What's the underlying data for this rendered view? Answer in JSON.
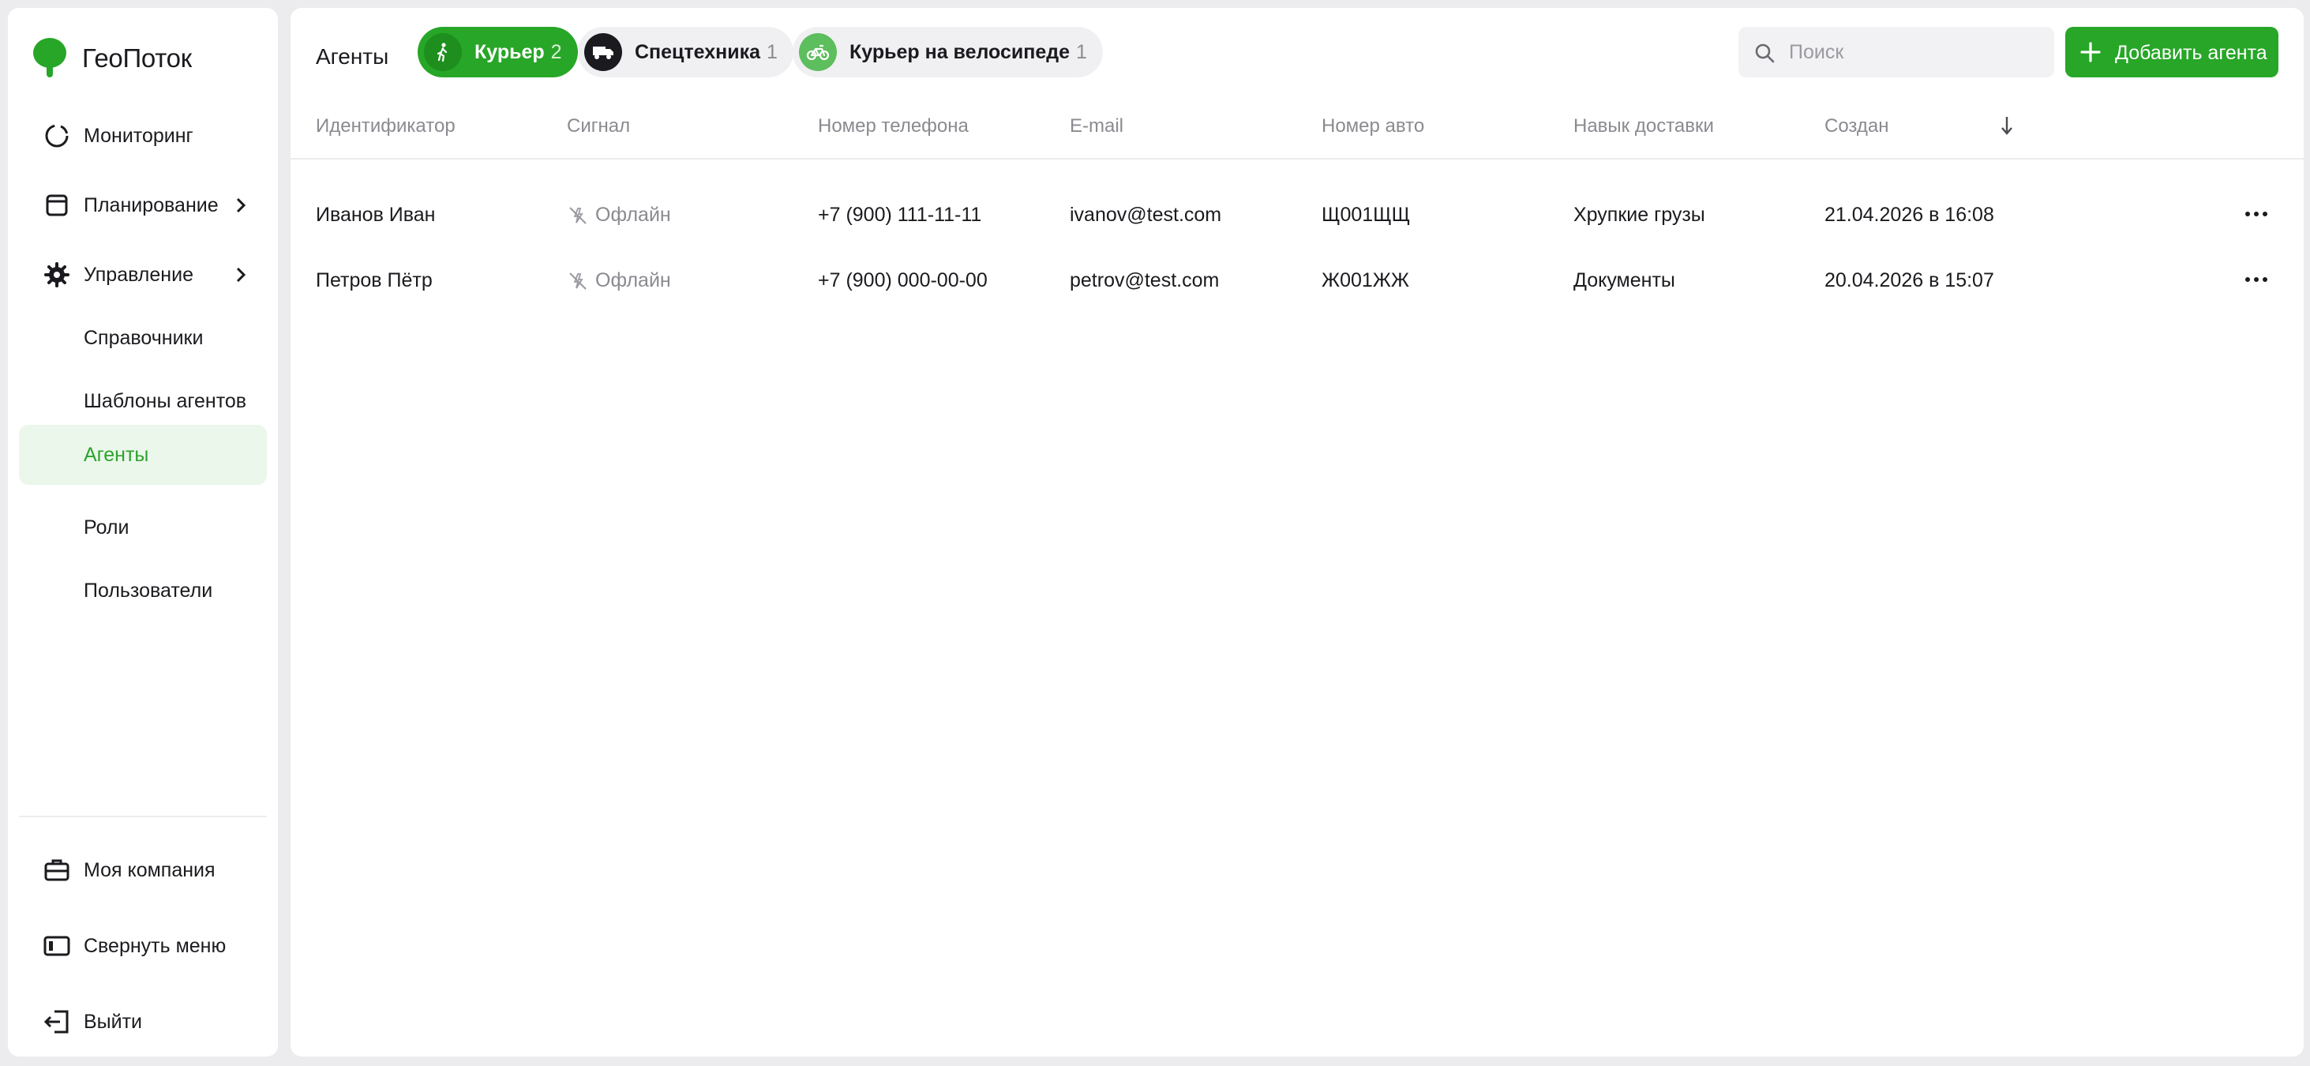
{
  "brand": {
    "title": "ГеоПоток",
    "color": "#27a627"
  },
  "sidebar": {
    "items": [
      {
        "label": "Мониторинг",
        "icon": "monitoring-icon"
      },
      {
        "label": "Планирование",
        "icon": "calendar-icon"
      },
      {
        "label": "Управление",
        "icon": "gear-icon"
      },
      {
        "label": "Справочники"
      },
      {
        "label": "Шаблоны агентов"
      },
      {
        "label": "Агенты",
        "active": true
      },
      {
        "label": "Роли"
      },
      {
        "label": "Пользователи"
      }
    ],
    "bottom": [
      {
        "label": "Моя компания",
        "icon": "briefcase-icon"
      },
      {
        "label": "Свернуть меню",
        "icon": "collapse-sidebar-icon"
      },
      {
        "label": "Выйти",
        "icon": "logout-icon"
      }
    ]
  },
  "header": {
    "title": "Агенты",
    "chips": [
      {
        "label": "Курьер",
        "count": "2",
        "icon": "walking-person-icon",
        "active": true
      },
      {
        "label": "Спецтехника",
        "count": "1",
        "icon": "truck-icon"
      },
      {
        "label": "Курьер на велосипеде",
        "count": "1",
        "icon": "bicycle-icon"
      }
    ],
    "search_placeholder": "Поиск",
    "add_button": "Добавить агента"
  },
  "table": {
    "columns": [
      "Идентификатор",
      "Сигнал",
      "Номер телефона",
      "E-mail",
      "Номер авто",
      "Навык доставки",
      "Создан"
    ],
    "sort": "descending",
    "rows": [
      {
        "id": "Иванов Иван",
        "signal": "Офлайн",
        "phone": "+7 (900) 111-11-11",
        "email": "ivanov@test.com",
        "car": "Щ001ЩЩ",
        "skill": "Хрупкие грузы",
        "created": "21.04.2026 в 16:08"
      },
      {
        "id": "Петров Пётр",
        "signal": "Офлайн",
        "phone": "+7 (900) 000-00-00",
        "email": "petrov@test.com",
        "car": "Ж001ЖЖ",
        "skill": "Документы",
        "created": "20.04.2026 в 15:07"
      }
    ]
  }
}
